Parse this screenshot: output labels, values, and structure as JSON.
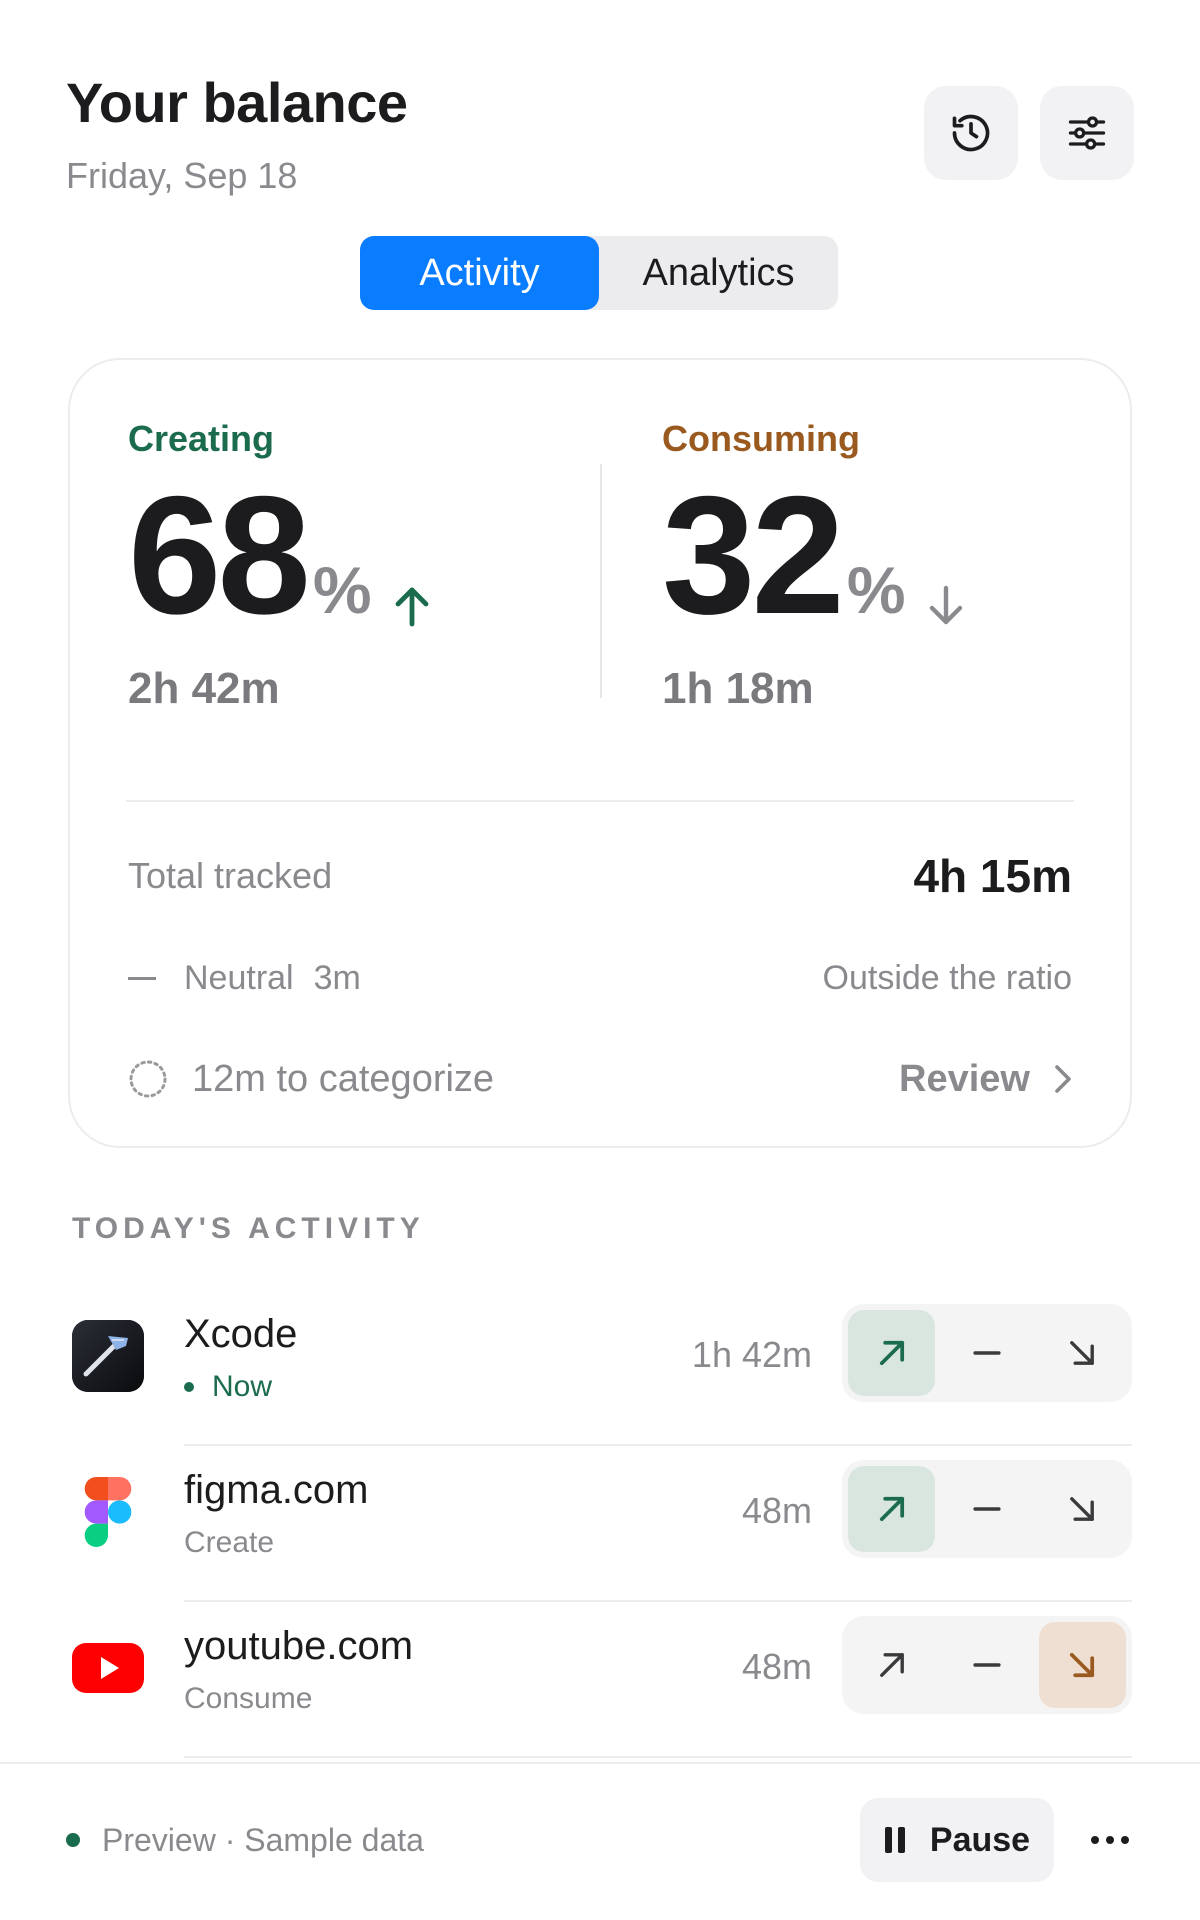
{
  "header": {
    "title": "Your balance",
    "date": "Friday, Sep 18"
  },
  "tabs": [
    {
      "label": "Activity",
      "active": true
    },
    {
      "label": "Analytics",
      "active": false
    }
  ],
  "summary": {
    "creating": {
      "label": "Creating",
      "percent": "68",
      "unit": "%",
      "trend": "up",
      "duration": "2h 42m",
      "color": "#1b6b4d"
    },
    "consuming": {
      "label": "Consuming",
      "percent": "32",
      "unit": "%",
      "trend": "down",
      "duration": "1h 18m",
      "color": "#9a5a1f"
    },
    "total_label": "Total tracked",
    "total_value": "4h 15m",
    "neutral_label": "Neutral",
    "neutral_time": "3m",
    "neutral_note": "Outside the ratio",
    "categorize_text": "12m to categorize",
    "review_label": "Review"
  },
  "activity": {
    "section_title": "TODAY'S ACTIVITY",
    "items": [
      {
        "name": "Xcode",
        "sub": "Now",
        "time": "1h 42m",
        "selected": "create",
        "icon": "xcode-icon"
      },
      {
        "name": "figma.com",
        "sub": "Create",
        "time": "48m",
        "selected": "create",
        "icon": "figma-icon"
      },
      {
        "name": "youtube.com",
        "sub": "Consume",
        "time": "48m",
        "selected": "consume",
        "icon": "youtube-icon"
      }
    ]
  },
  "footer": {
    "status": "Preview · Sample data",
    "pause_label": "Pause"
  },
  "colors": {
    "accent": "#0a7cff",
    "create": "#1b6b4d",
    "consume": "#9a5a1f"
  }
}
